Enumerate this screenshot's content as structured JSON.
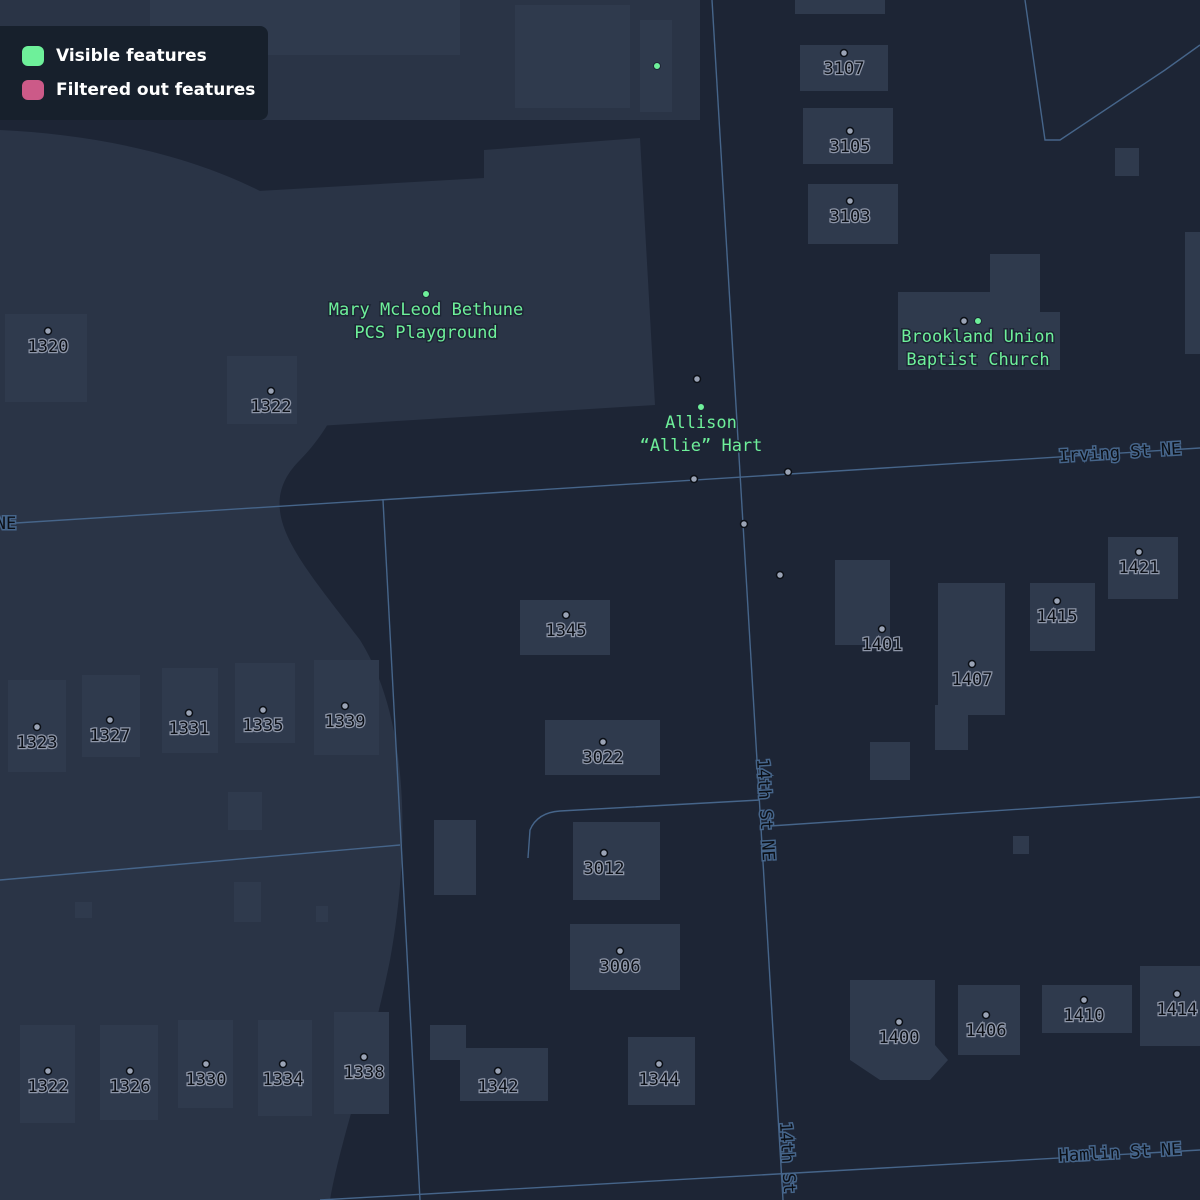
{
  "colors": {
    "background": "#1d2535",
    "park": "#2a3446",
    "building": "#2f3a4d",
    "road": "#46658a",
    "visible": "#6ef09a",
    "filtered": "#cc5a88",
    "address_text": "#0b0f16"
  },
  "legend": {
    "visible_label": "Visible features",
    "filtered_label": "Filtered out features"
  },
  "streets": {
    "irving": "Irving St NE",
    "irving_left": "NE",
    "fourteenth_a": "14th St NE",
    "fourteenth_b": "14th St",
    "hamlin": "Hamlin St NE"
  },
  "pois": {
    "playground": [
      "Mary McLeod Bethune",
      "PCS Playground"
    ],
    "church": [
      "Brookland Union",
      "Baptist Church"
    ],
    "memorial": [
      "Allison",
      "“Allie” Hart"
    ]
  },
  "addresses": [
    "3107",
    "3105",
    "3103",
    "1320",
    "1322",
    "1421",
    "1415",
    "1345",
    "1401",
    "1407",
    "1323",
    "1327",
    "1331",
    "1335",
    "1339",
    "3022",
    "3012",
    "3006",
    "1322",
    "1326",
    "1330",
    "1334",
    "1338",
    "1342",
    "1344",
    "1400",
    "1406",
    "1410",
    "1414"
  ]
}
